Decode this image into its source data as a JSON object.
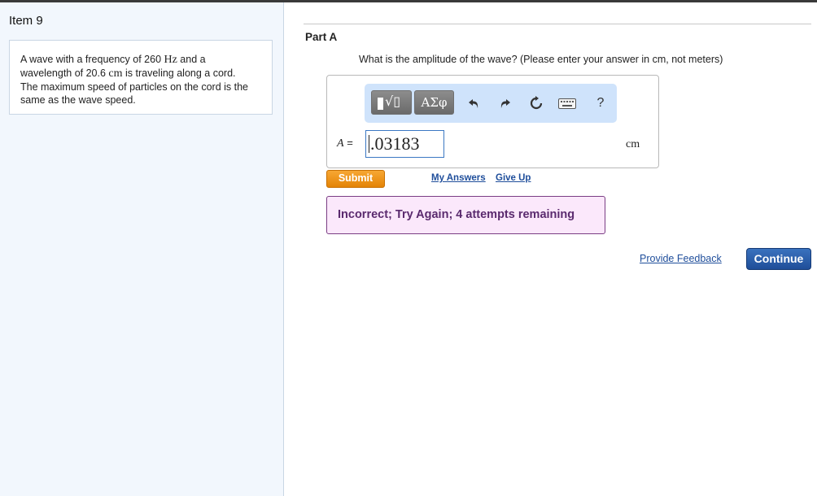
{
  "item": {
    "title": "Item 9"
  },
  "problem": {
    "line1_pre": "A wave with a frequency of 260 ",
    "line1_unit": "Hz",
    "line1_post": " and a",
    "line2_pre": "wavelength of 20.6 ",
    "line2_unit": "cm",
    "line2_post": " is traveling along a cord.",
    "line3": "The maximum speed of particles on the cord is the",
    "line4": "same as the wave speed."
  },
  "part": {
    "title": "Part A",
    "question": "What is the amplitude of the wave? (Please enter your answer in cm, not meters)"
  },
  "toolbar": {
    "greek_label": "ΑΣφ",
    "help_label": "?",
    "icons": [
      "template-icon",
      "undo-icon",
      "redo-icon",
      "reset-icon",
      "keyboard-icon",
      "help-icon"
    ]
  },
  "answer": {
    "variable": "A",
    "equals": "=",
    "value": ".03183",
    "units": "cm"
  },
  "actions": {
    "submit": "Submit",
    "my_answers": "My Answers",
    "give_up": "Give Up"
  },
  "feedback": {
    "message": "Incorrect; Try Again; 4 attempts remaining"
  },
  "footer": {
    "provide_feedback": "Provide Feedback",
    "continue": "Continue"
  },
  "colors": {
    "submit": "#f29a1f",
    "continue": "#2a5fa8",
    "feedback_bg": "#fbe8fb",
    "feedback_text": "#5a2a6e",
    "toolbar_bg": "#cfe3fb",
    "link": "#1f4e9b"
  }
}
